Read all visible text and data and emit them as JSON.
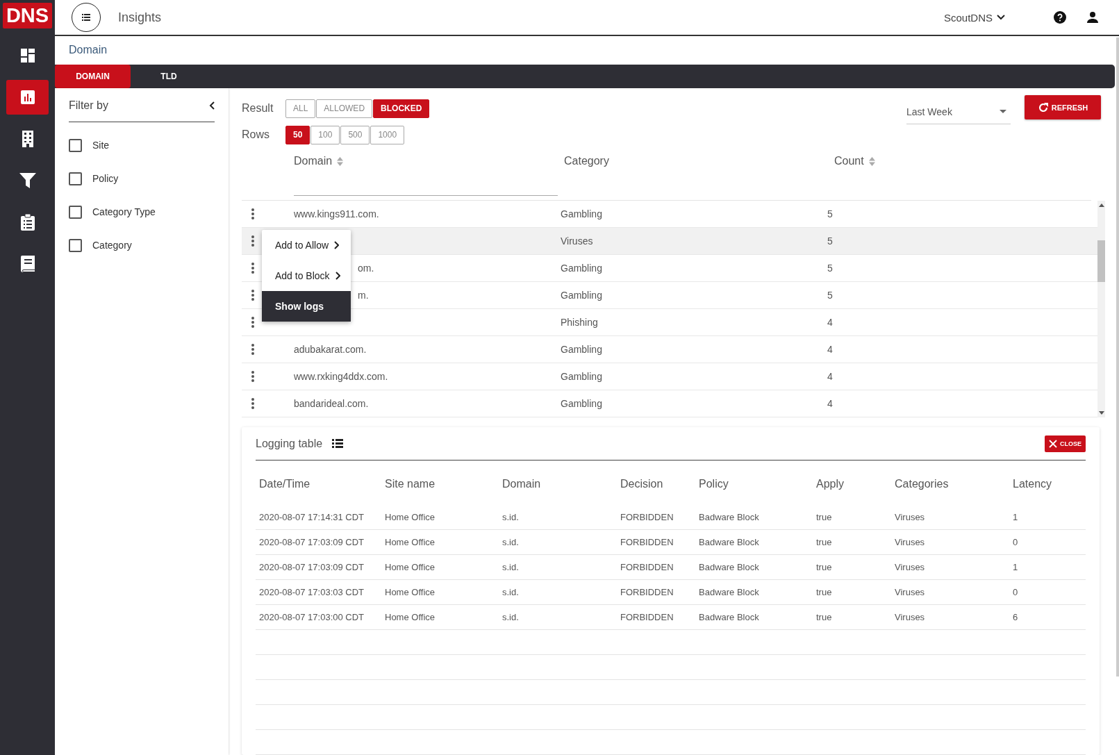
{
  "logo": "DNS",
  "sidebar": {
    "items": [
      {
        "selected": false
      },
      {
        "selected": true
      },
      {
        "selected": false
      },
      {
        "selected": false
      },
      {
        "selected": false
      },
      {
        "selected": false
      }
    ]
  },
  "header": {
    "title": "Insights",
    "account": "ScoutDNS"
  },
  "breadcrumb": "Domain",
  "tabs": [
    {
      "label": "DOMAIN",
      "selected": true
    },
    {
      "label": "TLD",
      "selected": false
    }
  ],
  "filter": {
    "title": "Filter by",
    "options": [
      {
        "label": "Site",
        "checked": false
      },
      {
        "label": "Policy",
        "checked": false
      },
      {
        "label": "Category Type",
        "checked": false
      },
      {
        "label": "Category",
        "checked": false
      }
    ]
  },
  "result": {
    "label": "Result",
    "options": [
      {
        "label": "ALL",
        "selected": false
      },
      {
        "label": "ALLOWED",
        "selected": false
      },
      {
        "label": "BLOCKED",
        "selected": true
      }
    ]
  },
  "rows_per_page": {
    "label": "Rows",
    "options": [
      {
        "label": "50",
        "selected": true
      },
      {
        "label": "100",
        "selected": false
      },
      {
        "label": "500",
        "selected": false
      },
      {
        "label": "1000",
        "selected": false
      }
    ]
  },
  "period": {
    "value": "Last Week"
  },
  "refresh_button": "REFRESH",
  "table": {
    "columns": [
      {
        "label": "Domain",
        "sortable": true
      },
      {
        "label": "Category",
        "sortable": false
      },
      {
        "label": "Count",
        "sortable": true
      }
    ],
    "rows": [
      {
        "domain": "www.kings911.com.",
        "category": "Gambling",
        "count": "5",
        "selected": false
      },
      {
        "category": "Viruses",
        "count": "5",
        "selected": true
      },
      {
        "domain": "om.",
        "partial": true,
        "category": "Gambling",
        "count": "5",
        "selected": false
      },
      {
        "domain": "m.",
        "partial": true,
        "category": "Gambling",
        "count": "5",
        "selected": false
      },
      {
        "category": "Phishing",
        "count": "4",
        "selected": false
      },
      {
        "domain": "adubakarat.com.",
        "category": "Gambling",
        "count": "4",
        "selected": false
      },
      {
        "domain": "www.rxking4ddx.com.",
        "category": "Gambling",
        "count": "4",
        "selected": false
      },
      {
        "domain": "bandarideal.com.",
        "category": "Gambling",
        "count": "4",
        "selected": false
      }
    ]
  },
  "context_menu": [
    {
      "label": "Add to Allow",
      "kind": "submenu",
      "selected": false
    },
    {
      "label": "Add to Block",
      "kind": "submenu",
      "selected": false
    },
    {
      "label": "Show logs",
      "kind": "action",
      "selected": true
    }
  ],
  "logging": {
    "title": "Logging table",
    "close_button": "CLOSE",
    "columns": [
      "Date/Time",
      "Site name",
      "Domain",
      "Decision",
      "Policy",
      "Apply",
      "Categories",
      "Latency"
    ],
    "rows": [
      [
        "2020-08-07 17:14:31 CDT",
        "Home Office",
        "s.id.",
        "FORBIDDEN",
        "Badware Block",
        "true",
        "Viruses",
        "1"
      ],
      [
        "2020-08-07 17:03:09 CDT",
        "Home Office",
        "s.id.",
        "FORBIDDEN",
        "Badware Block",
        "true",
        "Viruses",
        "0"
      ],
      [
        "2020-08-07 17:03:09 CDT",
        "Home Office",
        "s.id.",
        "FORBIDDEN",
        "Badware Block",
        "true",
        "Viruses",
        "1"
      ],
      [
        "2020-08-07 17:03:03 CDT",
        "Home Office",
        "s.id.",
        "FORBIDDEN",
        "Badware Block",
        "true",
        "Viruses",
        "0"
      ],
      [
        "2020-08-07 17:03:00 CDT",
        "Home Office",
        "s.id.",
        "FORBIDDEN",
        "Badware Block",
        "true",
        "Viruses",
        "6"
      ]
    ]
  }
}
